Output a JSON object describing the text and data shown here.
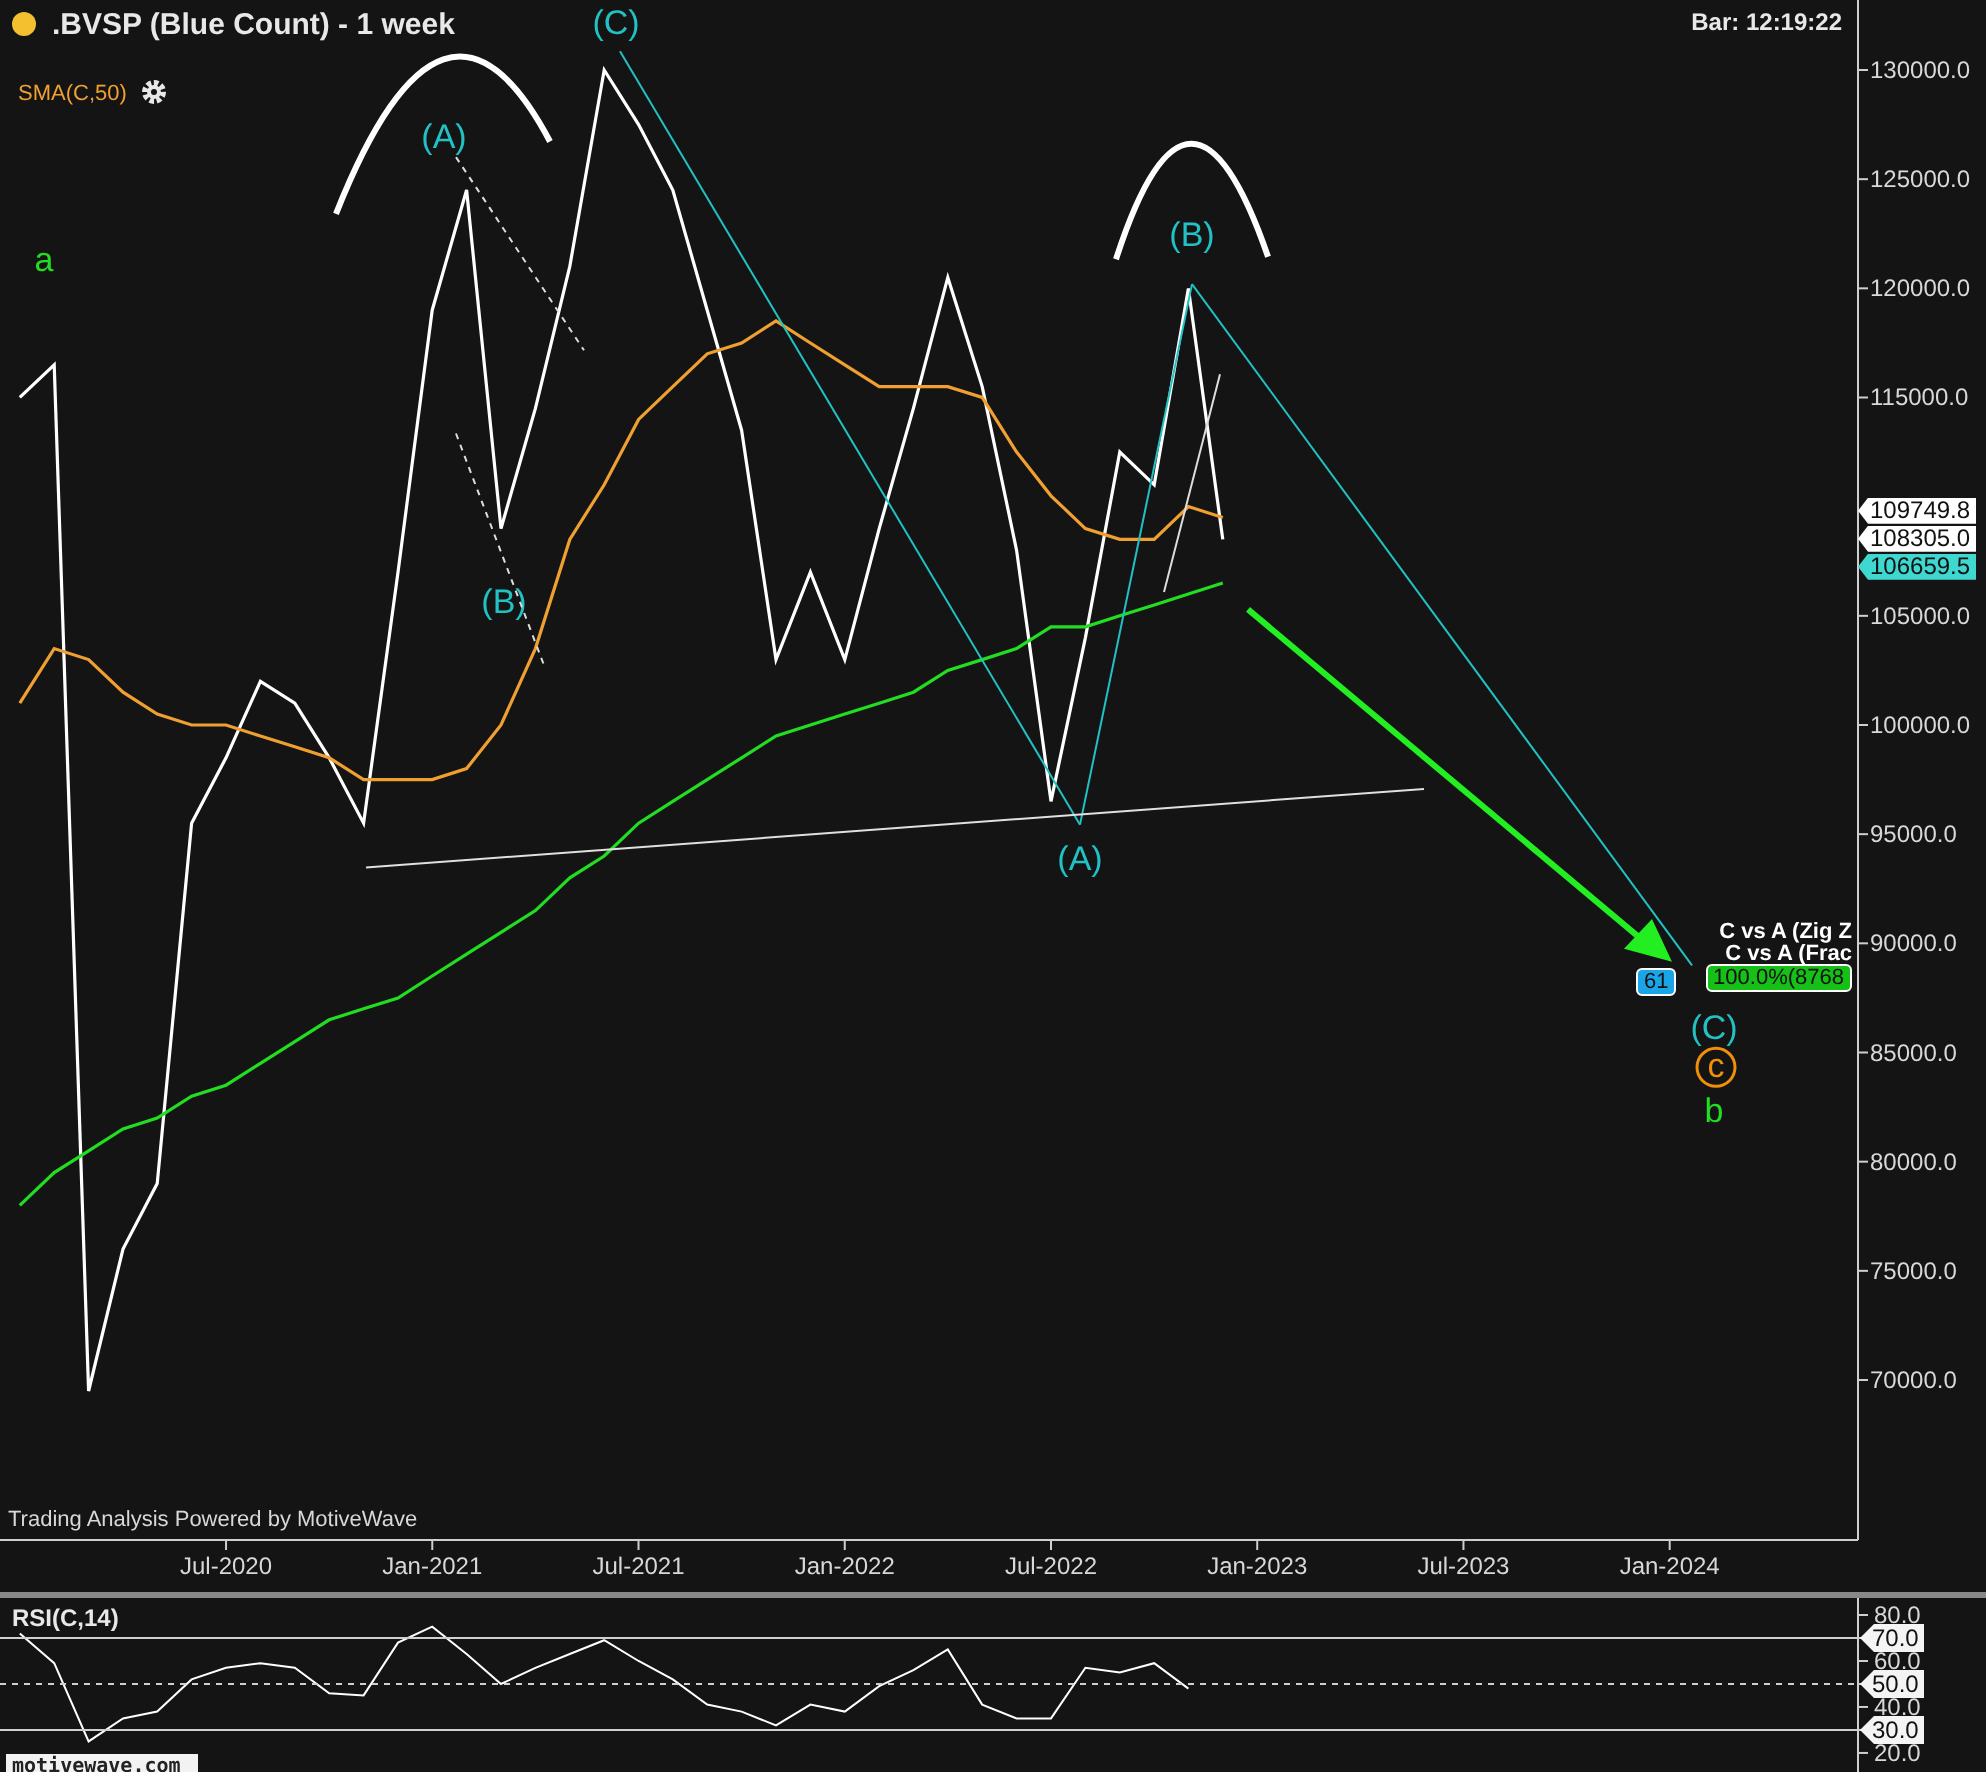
{
  "header": {
    "title": ".BVSP (Blue Count) - 1 week",
    "bar_time": "Bar: 12:19:22"
  },
  "main_chart": {
    "footer": "Trading Analysis Powered by MotiveWave",
    "price_tags": [
      {
        "text": "109749.8",
        "kind": "plain"
      },
      {
        "text": "108305.0",
        "kind": "plain"
      },
      {
        "text": "106659.5",
        "kind": "highlight"
      }
    ],
    "projection_labels": [
      {
        "text": "C vs A (Zig Z",
        "kind": "caption"
      },
      {
        "text": "C vs A (Frac",
        "kind": "caption"
      },
      {
        "text": "61",
        "kind": "blue"
      },
      {
        "text": "100.0%(8768",
        "kind": "green"
      }
    ],
    "wave_labels": [
      {
        "text": "a",
        "color": "#22dd22",
        "kind": "plain"
      },
      {
        "text": "(A)",
        "color": "#22c1c3",
        "kind": "plain"
      },
      {
        "text": "(B)",
        "color": "#22c1c3",
        "kind": "plain"
      },
      {
        "text": "(C)",
        "color": "#22c1c3",
        "kind": "plain"
      },
      {
        "text": "(A)",
        "color": "#22c1c3",
        "kind": "plain"
      },
      {
        "text": "(B)",
        "color": "#22c1c3",
        "kind": "plain"
      },
      {
        "text": "(C)",
        "color": "#22c1c3",
        "kind": "plain"
      },
      {
        "text": "c",
        "color": "#f0900a",
        "kind": "circled"
      },
      {
        "text": "b",
        "color": "#22dd22",
        "kind": "plain"
      }
    ],
    "chart_data": {
      "type": "line",
      "categories": [
        null,
        null,
        null,
        null,
        null,
        null,
        "Jul-2020",
        null,
        null,
        null,
        null,
        null,
        "Jan-2021",
        null,
        null,
        null,
        null,
        null,
        "Jul-2021",
        null,
        null,
        null,
        null,
        null,
        "Jan-2022",
        null,
        null,
        null,
        null,
        null,
        "Jul-2022",
        null,
        null,
        null,
        null,
        null,
        "Jan-2023",
        null,
        null,
        null,
        null,
        null,
        "Jul-2023",
        null,
        null,
        null,
        null,
        null,
        "Jan-2024",
        null,
        null,
        null,
        null,
        null
      ],
      "series": [
        {
          "color": "#ffffff",
          "values": [
            115000,
            116500,
            69500,
            76000,
            79000,
            95500,
            98500,
            102000,
            101000,
            98500,
            95500,
            107000,
            119000,
            124500,
            109000,
            114500,
            121000,
            130000,
            127500,
            124500,
            119000,
            113500,
            103000,
            107000,
            103000,
            109000,
            114500,
            120500,
            115500,
            108000,
            96500,
            104000,
            112500,
            111000,
            120000,
            108500,
            null,
            null,
            null,
            null,
            null,
            null,
            null,
            null,
            null,
            null,
            null,
            null,
            null,
            null,
            null,
            null,
            null,
            null
          ]
        },
        {
          "name": "SMA(C,50)",
          "color": "#f0a030",
          "values": [
            101000,
            103500,
            103000,
            101500,
            100500,
            100000,
            100000,
            99500,
            99000,
            98500,
            97500,
            97500,
            97500,
            98000,
            100000,
            103500,
            108500,
            111000,
            114000,
            115500,
            117000,
            117500,
            118500,
            117500,
            116500,
            115500,
            115500,
            115500,
            115000,
            112500,
            110500,
            109000,
            108500,
            108500,
            110000,
            109500,
            null,
            null,
            null,
            null,
            null,
            null,
            null,
            null,
            null,
            null,
            null,
            null,
            null,
            null,
            null,
            null,
            null,
            null
          ]
        },
        {
          "color": "#22dd22",
          "values": [
            78000,
            79500,
            80500,
            81500,
            82000,
            83000,
            83500,
            84500,
            85500,
            86500,
            87000,
            87500,
            88500,
            89500,
            90500,
            91500,
            93000,
            94000,
            95500,
            96500,
            97500,
            98500,
            99500,
            100000,
            100500,
            101000,
            101500,
            102500,
            103000,
            103500,
            104500,
            104500,
            105000,
            105500,
            106000,
            106500,
            null,
            null,
            null,
            null,
            null,
            null,
            null,
            null,
            null,
            null,
            null,
            null,
            null,
            null,
            null,
            null,
            null,
            null
          ]
        }
      ],
      "ylim": [
        62672,
        133206
      ],
      "yticks": [
        {
          "value": 130000,
          "label": "130000.0"
        },
        {
          "value": 125000,
          "label": "125000.0"
        },
        {
          "value": 120000,
          "label": "120000.0"
        },
        {
          "value": 115000,
          "label": "115000.0"
        },
        {
          "value": 105000,
          "label": "105000.0"
        },
        {
          "value": 100000,
          "label": "100000.0"
        },
        {
          "value": 95000,
          "label": "95000.0"
        },
        {
          "value": 90000,
          "label": "90000.0"
        },
        {
          "value": 85000,
          "label": "85000.0"
        },
        {
          "value": 80000,
          "label": "80000.0"
        },
        {
          "value": 75000,
          "label": "75000.0"
        },
        {
          "value": 70000,
          "label": "70000.0"
        }
      ]
    }
  },
  "rsi_panel": {
    "logo": "motivewave.com",
    "chart_data": {
      "type": "line",
      "title": "RSI(C,14)",
      "categories": [
        null,
        null,
        null,
        null,
        null,
        null,
        null,
        null,
        null,
        null,
        null,
        null,
        null,
        null,
        null,
        null,
        null,
        null,
        null,
        null,
        null,
        null,
        null,
        null,
        null,
        null,
        null,
        null,
        null,
        null,
        null,
        null,
        null,
        null,
        null,
        null,
        null,
        null,
        null,
        null,
        null,
        null,
        null,
        null,
        null,
        null,
        null,
        null,
        null,
        null,
        null,
        null,
        null,
        null
      ],
      "series": [
        {
          "color": "#ffffff",
          "values": [
            72,
            59,
            25,
            35,
            38,
            52,
            57,
            59,
            57,
            46,
            45,
            68,
            75,
            63,
            50,
            57,
            63,
            69,
            60,
            52,
            41,
            38,
            32,
            41,
            38,
            49,
            56,
            65,
            41,
            35,
            35,
            57,
            55,
            59,
            48,
            null,
            null,
            null,
            null,
            null,
            null,
            null,
            null,
            null,
            null,
            null,
            null,
            null,
            null,
            null,
            null,
            null,
            null,
            null
          ]
        }
      ],
      "ylim": [
        9.1,
        87.4
      ],
      "yticks": [
        {
          "value": 80,
          "label": "80.0"
        },
        {
          "value": 70,
          "label": "70.0"
        },
        {
          "value": 60,
          "label": "60.0"
        },
        {
          "value": 50,
          "label": "50.0"
        },
        {
          "value": 40,
          "label": "40.0"
        },
        {
          "value": 30,
          "label": "30.0"
        },
        {
          "value": 20,
          "label": "20.0"
        }
      ]
    }
  }
}
